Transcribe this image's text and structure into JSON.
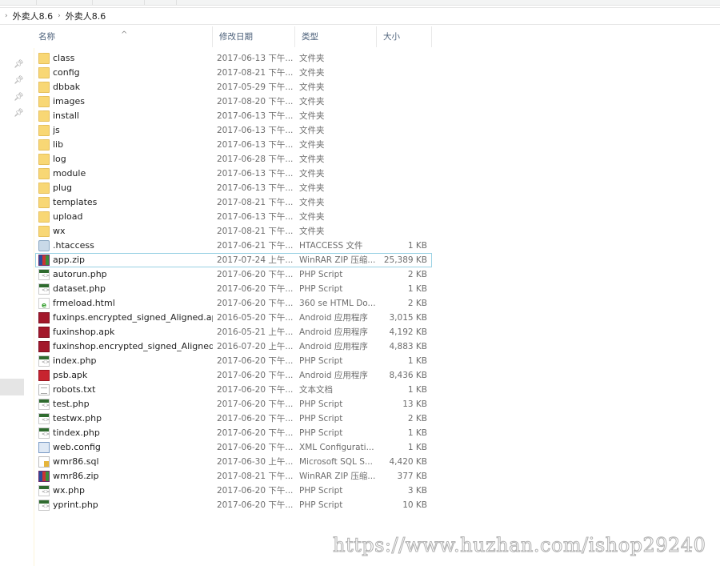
{
  "breadcrumb": [
    "外卖人8.6",
    "外卖人8.6"
  ],
  "columns": {
    "name": "名称",
    "date": "修改日期",
    "type": "类型",
    "size": "大小"
  },
  "sort_indicator": "^",
  "quick_access_pins": 4,
  "selected_file": "app.zip",
  "files": [
    {
      "name": "class",
      "date": "2017-06-13 下午...",
      "type": "文件夹",
      "size": "",
      "icon": "folder"
    },
    {
      "name": "config",
      "date": "2017-08-21 下午...",
      "type": "文件夹",
      "size": "",
      "icon": "folder"
    },
    {
      "name": "dbbak",
      "date": "2017-05-29 下午...",
      "type": "文件夹",
      "size": "",
      "icon": "folder"
    },
    {
      "name": "images",
      "date": "2017-08-20 下午...",
      "type": "文件夹",
      "size": "",
      "icon": "folder"
    },
    {
      "name": "install",
      "date": "2017-06-13 下午...",
      "type": "文件夹",
      "size": "",
      "icon": "folder"
    },
    {
      "name": "js",
      "date": "2017-06-13 下午...",
      "type": "文件夹",
      "size": "",
      "icon": "folder"
    },
    {
      "name": "lib",
      "date": "2017-06-13 下午...",
      "type": "文件夹",
      "size": "",
      "icon": "folder"
    },
    {
      "name": "log",
      "date": "2017-06-28 下午...",
      "type": "文件夹",
      "size": "",
      "icon": "folder"
    },
    {
      "name": "module",
      "date": "2017-06-13 下午...",
      "type": "文件夹",
      "size": "",
      "icon": "folder"
    },
    {
      "name": "plug",
      "date": "2017-06-13 下午...",
      "type": "文件夹",
      "size": "",
      "icon": "folder"
    },
    {
      "name": "templates",
      "date": "2017-08-21 下午...",
      "type": "文件夹",
      "size": "",
      "icon": "folder"
    },
    {
      "name": "upload",
      "date": "2017-06-13 下午...",
      "type": "文件夹",
      "size": "",
      "icon": "folder"
    },
    {
      "name": "wx",
      "date": "2017-08-21 下午...",
      "type": "文件夹",
      "size": "",
      "icon": "folder"
    },
    {
      "name": ".htaccess",
      "date": "2017-06-21 下午...",
      "type": "HTACCESS 文件",
      "size": "1 KB",
      "icon": "ht"
    },
    {
      "name": "app.zip",
      "date": "2017-07-24 上午...",
      "type": "WinRAR ZIP 压缩...",
      "size": "25,389 KB",
      "icon": "zip"
    },
    {
      "name": "autorun.php",
      "date": "2017-06-20 下午...",
      "type": "PHP Script",
      "size": "2 KB",
      "icon": "php"
    },
    {
      "name": "dataset.php",
      "date": "2017-06-20 下午...",
      "type": "PHP Script",
      "size": "1 KB",
      "icon": "php"
    },
    {
      "name": "frmeload.html",
      "date": "2017-06-20 下午...",
      "type": "360 se HTML Do...",
      "size": "2 KB",
      "icon": "html"
    },
    {
      "name": "fuxinps.encrypted_signed_Aligned.apk",
      "date": "2016-05-20 下午...",
      "type": "Android 应用程序",
      "size": "3,015 KB",
      "icon": "apk"
    },
    {
      "name": "fuxinshop.apk",
      "date": "2016-05-21 上午...",
      "type": "Android 应用程序",
      "size": "4,192 KB",
      "icon": "apk"
    },
    {
      "name": "fuxinshop.encrypted_signed_Aligned....",
      "date": "2016-07-20 上午...",
      "type": "Android 应用程序",
      "size": "4,883 KB",
      "icon": "apk"
    },
    {
      "name": "index.php",
      "date": "2017-06-20 下午...",
      "type": "PHP Script",
      "size": "1 KB",
      "icon": "php"
    },
    {
      "name": "psb.apk",
      "date": "2017-06-20 下午...",
      "type": "Android 应用程序",
      "size": "8,436 KB",
      "icon": "apk2"
    },
    {
      "name": "robots.txt",
      "date": "2017-06-20 下午...",
      "type": "文本文档",
      "size": "1 KB",
      "icon": "txt"
    },
    {
      "name": "test.php",
      "date": "2017-06-20 下午...",
      "type": "PHP Script",
      "size": "13 KB",
      "icon": "php"
    },
    {
      "name": "testwx.php",
      "date": "2017-06-20 下午...",
      "type": "PHP Script",
      "size": "2 KB",
      "icon": "php"
    },
    {
      "name": "tindex.php",
      "date": "2017-06-20 下午...",
      "type": "PHP Script",
      "size": "1 KB",
      "icon": "php"
    },
    {
      "name": "web.config",
      "date": "2017-06-20 下午...",
      "type": "XML Configurati...",
      "size": "1 KB",
      "icon": "config"
    },
    {
      "name": "wmr86.sql",
      "date": "2017-06-30 上午...",
      "type": "Microsoft SQL S...",
      "size": "4,420 KB",
      "icon": "sql"
    },
    {
      "name": "wmr86.zip",
      "date": "2017-08-21 下午...",
      "type": "WinRAR ZIP 压缩...",
      "size": "377 KB",
      "icon": "zip"
    },
    {
      "name": "wx.php",
      "date": "2017-06-20 下午...",
      "type": "PHP Script",
      "size": "3 KB",
      "icon": "php"
    },
    {
      "name": "yprint.php",
      "date": "2017-06-20 下午...",
      "type": "PHP Script",
      "size": "10 KB",
      "icon": "php"
    }
  ],
  "watermark": "https://www.huzhan.com/ishop29240"
}
